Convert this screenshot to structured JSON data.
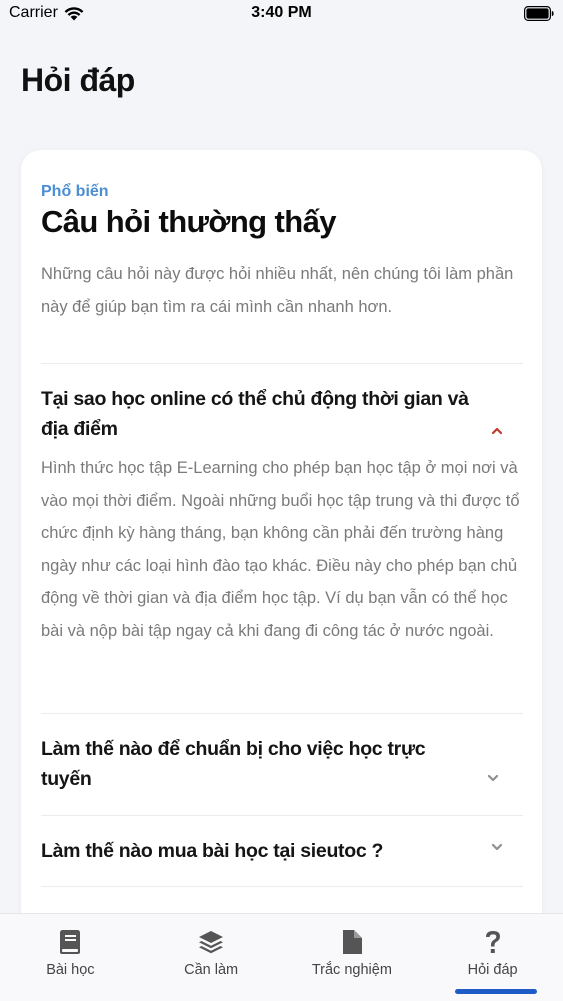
{
  "status_bar": {
    "carrier": "Carrier",
    "time": "3:40 PM"
  },
  "header": {
    "title": "Hỏi đáp"
  },
  "faq": {
    "eyebrow": "Phổ biến",
    "title": "Câu hỏi thường thấy",
    "description": "Những câu hỏi này được hỏi nhiều nhất, nên chúng tôi làm phần này để giúp bạn tìm ra cái mình cần nhanh hơn.",
    "items": [
      {
        "question": "Tại sao học online có thể chủ động thời gian và địa điểm",
        "expanded": true,
        "answer": "Hình thức học tập E-Learning cho phép bạn học tập ở mọi nơi và vào mọi thời điểm. Ngoài những buổi học tập trung và thi được tổ chức định kỳ hàng tháng, bạn không cần phải đến trường hàng ngày như các loại hình đào tạo khác. Điều này cho phép bạn chủ động về thời gian và địa điểm học tập. Ví dụ bạn vẫn có thể học bài và nộp bài tập ngay cả khi đang đi công tác ở nước ngoài."
      },
      {
        "question": "Làm thế nào để chuẩn bị cho việc học trực tuyến",
        "expanded": false
      },
      {
        "question": "Làm thế nào mua bài học tại sieutoc ?",
        "expanded": false
      }
    ]
  },
  "tab_bar": {
    "tabs": [
      {
        "label": "Bài học",
        "icon": "book-icon",
        "active": false
      },
      {
        "label": "Cần làm",
        "icon": "layers-icon",
        "active": false
      },
      {
        "label": "Trắc nghiệm",
        "icon": "document-icon",
        "active": false
      },
      {
        "label": "Hỏi đáp",
        "icon": "question-icon",
        "active": true
      }
    ]
  },
  "colors": {
    "accent": "#4b8ed2",
    "active_tab_indicator": "#1e5bc6",
    "chevron_expanded": "#c0392b",
    "chevron_collapsed": "#8e8e93",
    "tab_icon": "#555555"
  }
}
